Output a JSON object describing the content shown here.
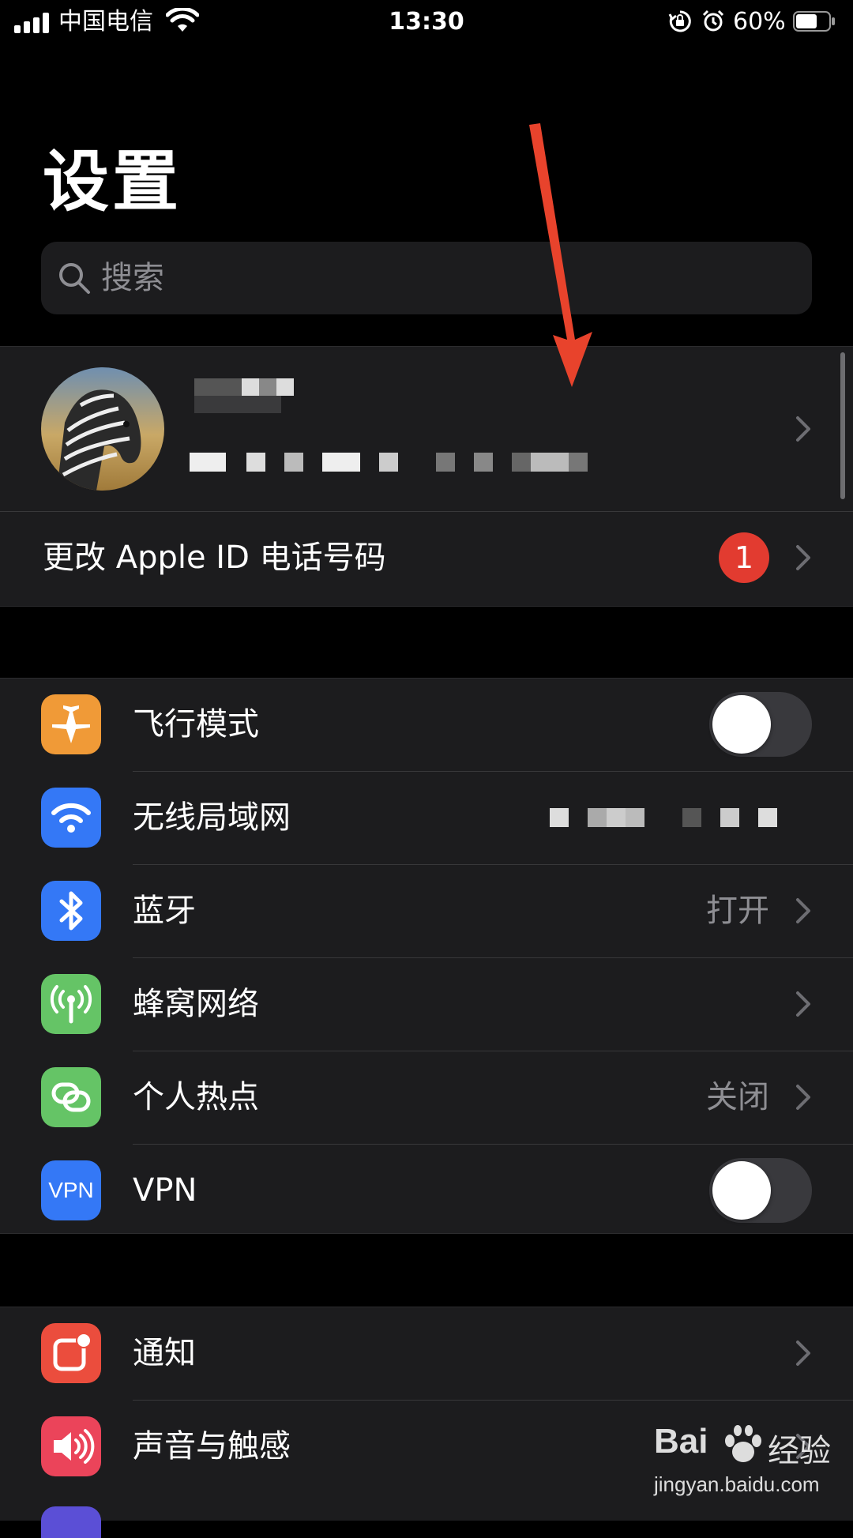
{
  "status_bar": {
    "carrier": "中国电信",
    "time": "13:30",
    "battery_pct": "60%"
  },
  "title": "设置",
  "search": {
    "placeholder": "搜索"
  },
  "account": {
    "change_phone_label": "更改 Apple ID 电话号码",
    "badge_count": "1"
  },
  "connectivity": [
    {
      "label": "飞行模式",
      "icon": "airplane-icon",
      "color": "#f09a37",
      "control": "toggle",
      "on": false
    },
    {
      "label": "无线局域网",
      "icon": "wifi-icon",
      "color": "#3478f6",
      "control": "redacted"
    },
    {
      "label": "蓝牙",
      "icon": "bluetooth-icon",
      "color": "#3478f6",
      "value": "打开",
      "control": "chevron"
    },
    {
      "label": "蜂窝网络",
      "icon": "cellular-antenna-icon",
      "color": "#65c466",
      "control": "chevron"
    },
    {
      "label": "个人热点",
      "icon": "hotspot-link-icon",
      "color": "#65c466",
      "value": "关闭",
      "control": "chevron"
    },
    {
      "label": "VPN",
      "icon": "vpn-icon",
      "color": "#3478f6",
      "icon_text": "VPN",
      "control": "toggle",
      "on": false
    }
  ],
  "notifications_group": [
    {
      "label": "通知",
      "icon": "notification-icon",
      "color": "#eb4d3d"
    },
    {
      "label": "声音与触感",
      "icon": "speaker-icon",
      "color": "#eb445a"
    }
  ],
  "watermark": {
    "brand": "Bai",
    "brand_suffix": "经验",
    "url": "jingyan.baidu.com"
  },
  "colors": {
    "background": "#000000",
    "cell": "#1c1c1e",
    "secondary_text": "#8e8e93",
    "badge": "#e23b30",
    "annotation_arrow": "#e8432c"
  }
}
